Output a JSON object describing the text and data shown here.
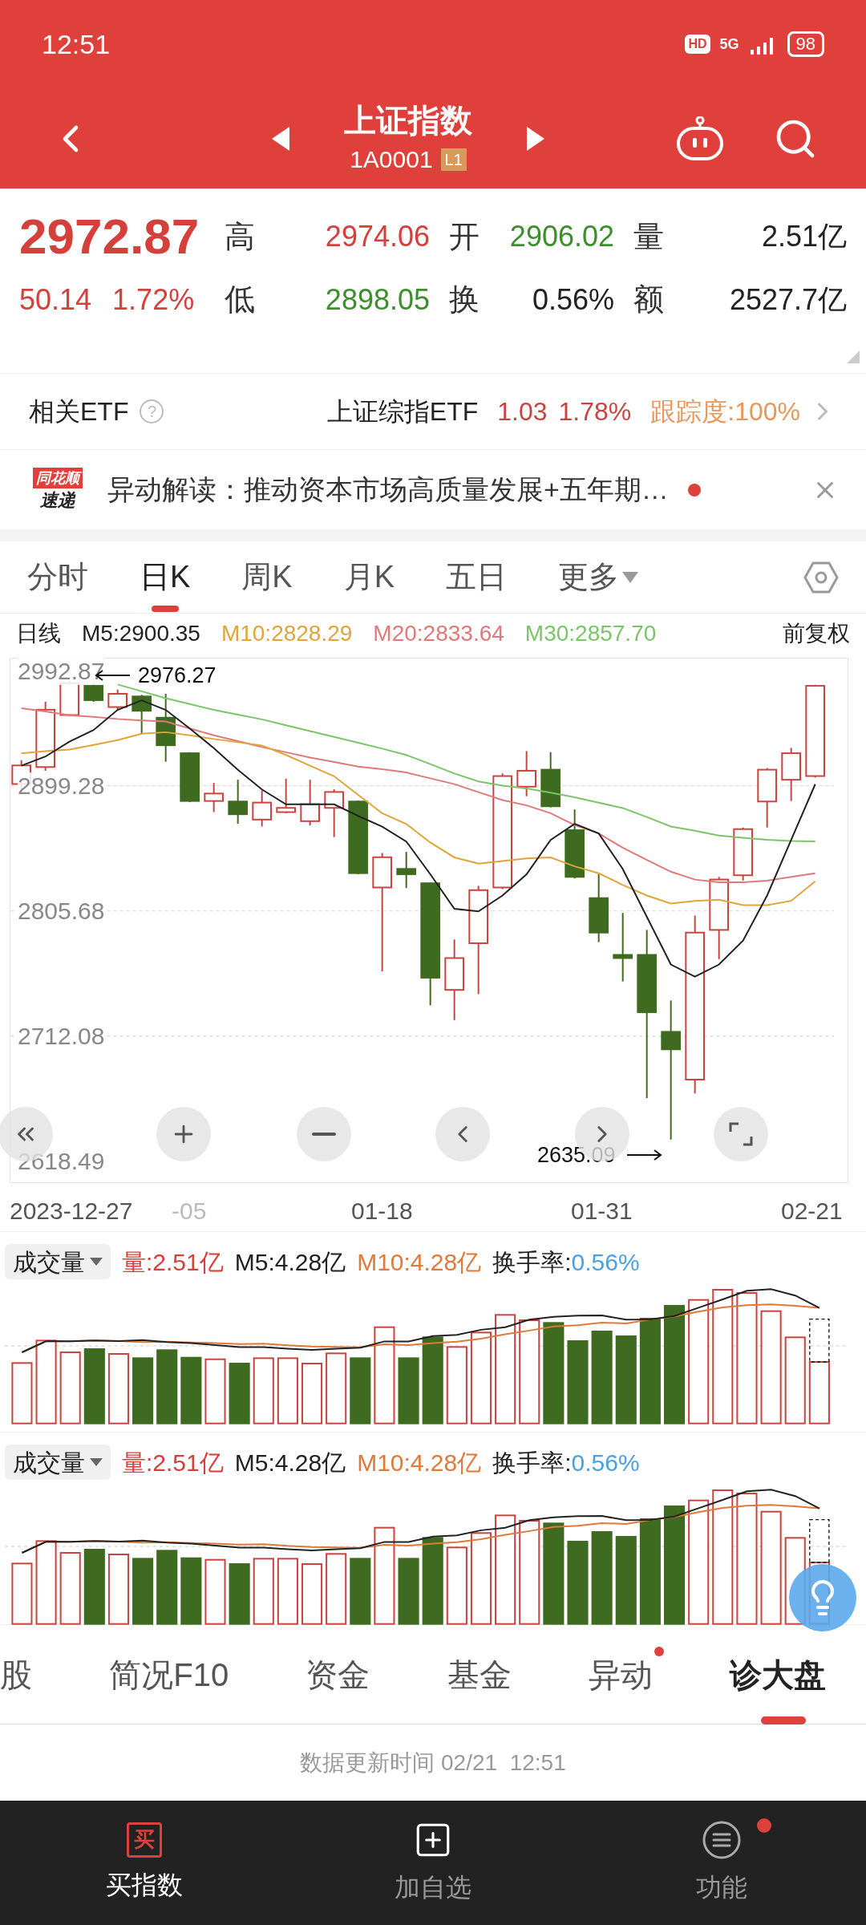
{
  "status_bar": {
    "time": "12:51",
    "hd": "HD",
    "network": "5G",
    "battery": "98"
  },
  "header": {
    "title": "上证指数",
    "code": "1A0001",
    "badge": "L1"
  },
  "quote": {
    "price": "2972.87",
    "change": "50.14",
    "change_pct": "1.72%",
    "stats": [
      {
        "label": "高",
        "value": "2974.06",
        "color": "#d6403a"
      },
      {
        "label": "开",
        "value": "2906.02",
        "color": "#3d8f2e"
      },
      {
        "label": "量",
        "value": "2.51亿",
        "color": "#222222"
      },
      {
        "label": "低",
        "value": "2898.05",
        "color": "#3d8f2e"
      },
      {
        "label": "换",
        "value": "0.56%",
        "color": "#222222"
      },
      {
        "label": "额",
        "value": "2527.7亿",
        "color": "#222222"
      }
    ]
  },
  "etf": {
    "label": "相关ETF",
    "help": "?",
    "name": "上证综指ETF",
    "price": "1.03",
    "pct": "1.78%",
    "tracking": "跟踪度:100%"
  },
  "news": {
    "logo_top": "同花顺",
    "logo_bottom": "速递",
    "text": "异动解读：推动资本市场高质量发展+五年期…",
    "unread": true
  },
  "chart_tabs": [
    {
      "label": "分时",
      "selected": false,
      "kind": "tab"
    },
    {
      "label": "日K",
      "selected": true,
      "kind": "tab"
    },
    {
      "label": "周K",
      "selected": false,
      "kind": "tab"
    },
    {
      "label": "月K",
      "selected": false,
      "kind": "tab"
    },
    {
      "label": "五日",
      "selected": false,
      "kind": "tab"
    },
    {
      "label": "更多",
      "selected": false,
      "kind": "dropdown"
    }
  ],
  "ma_row": {
    "label": "日线",
    "adjust": "前复权"
  },
  "kline": {
    "high_marker": "2976.27",
    "low_marker": "2635.09",
    "chart_data": {
      "type": "line",
      "grid": true,
      "ylim": [
        2602.2,
        2995.0
      ],
      "yticks": [
        {
          "value": 2992.87,
          "label": "2992.87"
        },
        {
          "value": 2899.28,
          "label": "2899.28"
        },
        {
          "value": 2805.68,
          "label": "2805.68"
        },
        {
          "value": 2712.08,
          "label": "2712.08"
        },
        {
          "value": 2618.49,
          "label": "2618.49"
        }
      ],
      "series": [
        {
          "name": "M5:2900.35",
          "color": "#222222",
          "values": [
            2914.3,
            2921.1,
            2932.2,
            2940.9,
            2956.0,
            2963.1,
            2956.0,
            2942.1,
            2927.4,
            2911.2,
            2896.5,
            2885.4,
            2885.4,
            2885.4,
            2876.7,
            2868.7,
            2857.6,
            2833.1,
            2807.3,
            2805.3,
            2817.2,
            2833.1,
            2858.8,
            2870.8,
            2863.6,
            2837.0,
            2801.3,
            2765.6,
            2756.5,
            2765.6,
            2783.5,
            2817.2,
            2858.8,
            2900.4
          ]
        },
        {
          "name": "M10:2828.29",
          "color": "#e0a43a",
          "values": [
            2923.5,
            2925.1,
            2926.3,
            2929.8,
            2933.4,
            2938.2,
            2939.3,
            2937.0,
            2934.2,
            2931.8,
            2929.4,
            2922.3,
            2914.3,
            2906.4,
            2892.5,
            2878.7,
            2870.7,
            2856.8,
            2845.7,
            2841.0,
            2843.0,
            2844.9,
            2845.7,
            2839.0,
            2833.8,
            2825.1,
            2817.2,
            2811.2,
            2813.2,
            2814.0,
            2810.0,
            2810.0,
            2813.2,
            2827.9
          ]
        },
        {
          "name": "M20:2833.64",
          "color": "#e07a7a",
          "values": [
            2957.2,
            2954.8,
            2952.0,
            2950.8,
            2949.2,
            2948.1,
            2947.3,
            2942.1,
            2937.0,
            2932.6,
            2928.2,
            2924.3,
            2920.3,
            2917.1,
            2913.6,
            2911.6,
            2909.2,
            2904.8,
            2900.5,
            2894.5,
            2888.6,
            2884.6,
            2878.7,
            2869.9,
            2863.6,
            2852.9,
            2843.8,
            2835.0,
            2829.1,
            2827.1,
            2827.1,
            2828.3,
            2831.1,
            2833.8
          ]
        },
        {
          "name": "M30:2857.70",
          "color": "#7cc46a",
          "values": [
            null,
            null,
            null,
            null,
            2975.0,
            2969.9,
            2964.7,
            2960.4,
            2956.0,
            2952.4,
            2948.9,
            2944.5,
            2940.1,
            2935.8,
            2931.4,
            2927.0,
            2922.3,
            2915.5,
            2908.4,
            2902.5,
            2899.3,
            2897.3,
            2894.1,
            2890.6,
            2886.6,
            2882.6,
            2875.9,
            2868.8,
            2865.6,
            2862.0,
            2860.4,
            2858.9,
            2858.0,
            2857.6
          ]
        }
      ]
    },
    "x_labels": [
      {
        "text": "2023-12-27",
        "faded": false
      },
      {
        "text": "-05",
        "faded": true
      },
      {
        "text": "01-18",
        "faded": false
      },
      {
        "text": "01-31",
        "faded": false
      },
      {
        "text": "02-21",
        "faded": false
      }
    ]
  },
  "volume_panels": [
    {
      "selector": "成交量",
      "volume": "量:2.51亿",
      "m5": "M5:4.28亿",
      "m10": "M10:4.28亿",
      "turnover_label": "换手率:",
      "turnover": "0.56%"
    },
    {
      "selector": "成交量",
      "volume": "量:2.51亿",
      "m5": "M5:4.28亿",
      "m10": "M10:4.28亿",
      "turnover_label": "换手率:",
      "turnover": "0.56%"
    }
  ],
  "bottom_tabs": [
    {
      "label": "股",
      "selected": false,
      "dot": false
    },
    {
      "label": "简况F10",
      "selected": false,
      "dot": false
    },
    {
      "label": "资金",
      "selected": false,
      "dot": false
    },
    {
      "label": "基金",
      "selected": false,
      "dot": false
    },
    {
      "label": "异动",
      "selected": false,
      "dot": true
    },
    {
      "label": "诊大盘",
      "selected": true,
      "dot": false
    }
  ],
  "update_time": "数据更新时间 02/21  12:51",
  "bottom_nav": [
    {
      "label": "买指数",
      "kind": "buy",
      "icon_text": "买",
      "dot": false
    },
    {
      "label": "加自选",
      "kind": "add",
      "dot": false
    },
    {
      "label": "功能",
      "kind": "menu",
      "dot": true
    }
  ]
}
